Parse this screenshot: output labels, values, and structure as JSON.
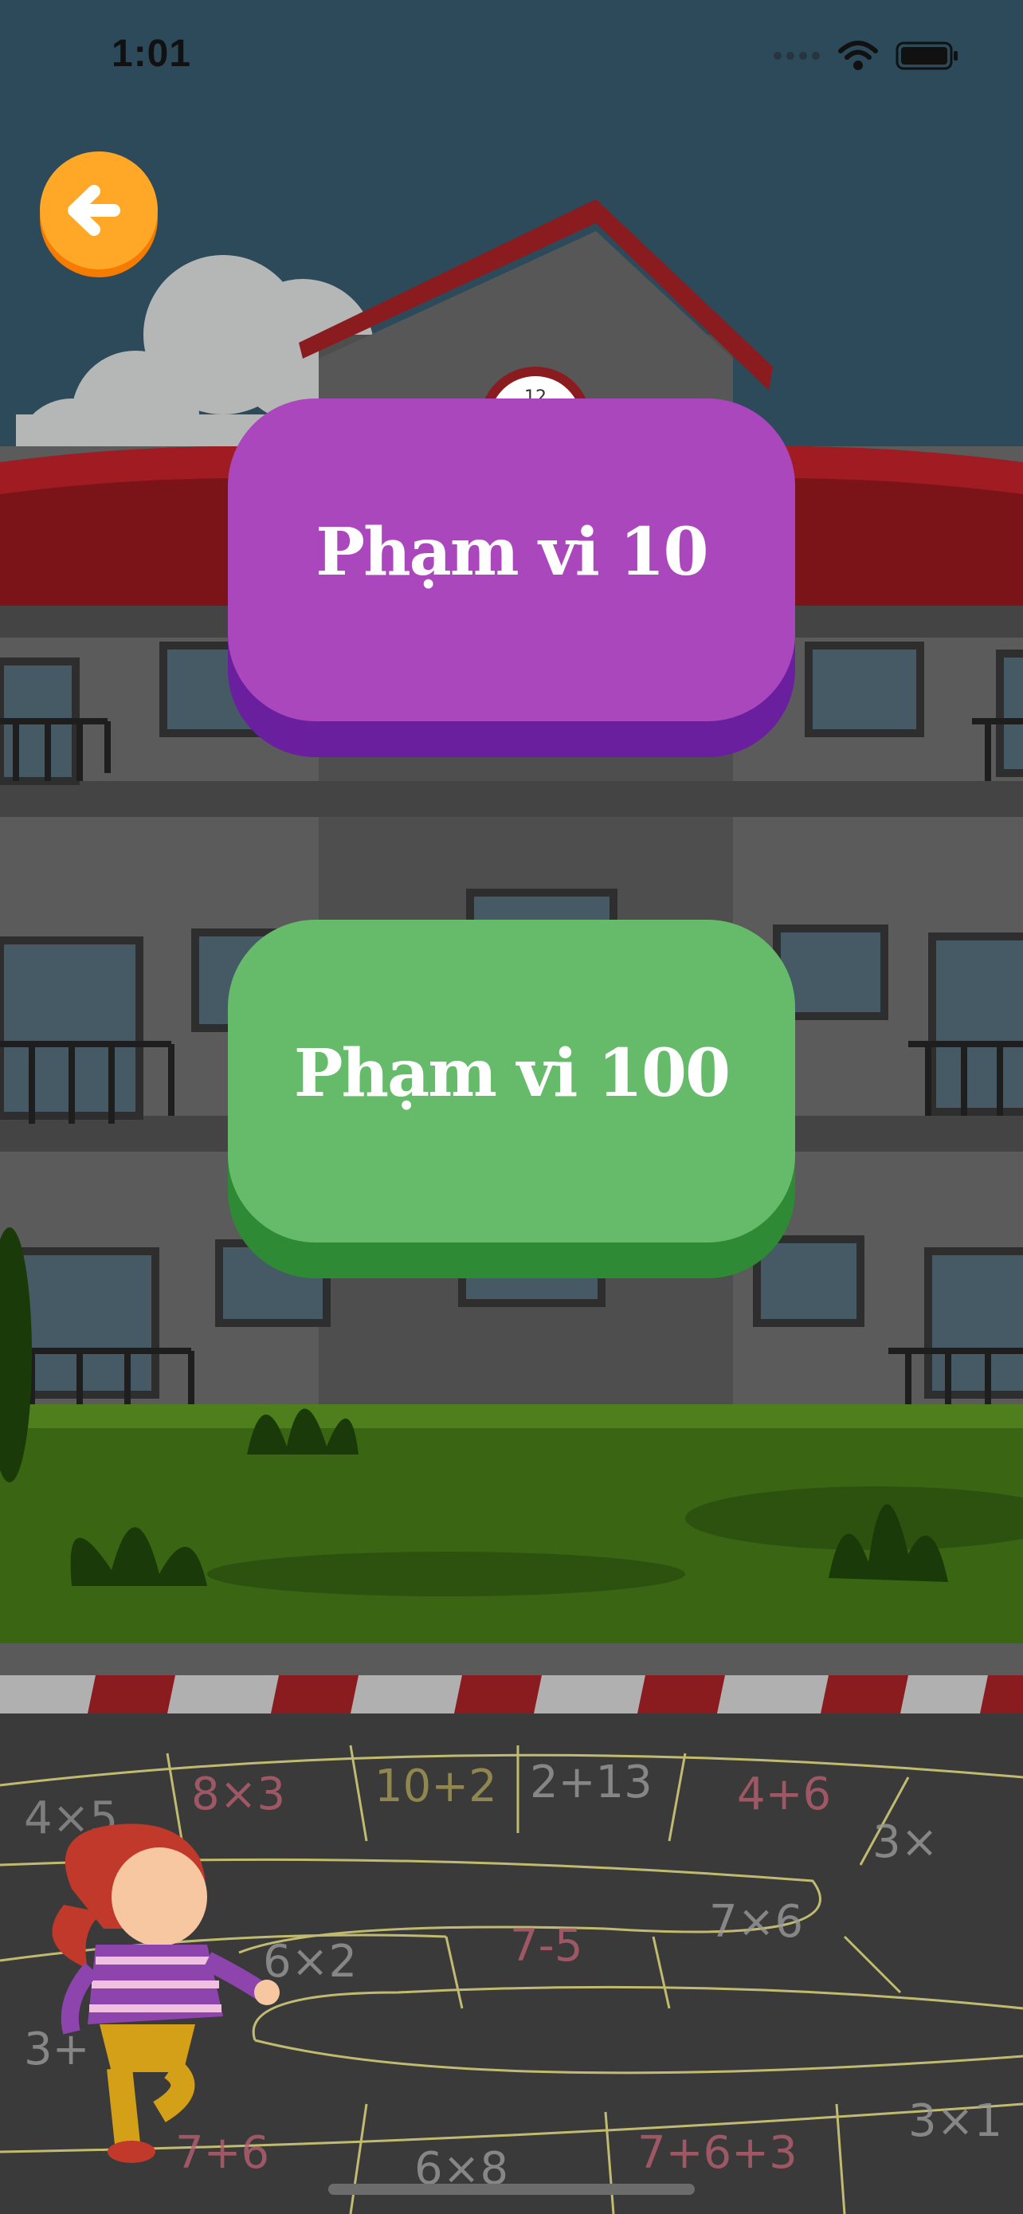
{
  "status_bar": {
    "time": "1:01"
  },
  "buttons": {
    "range_10": "Phạm vi 10",
    "range_100": "Phạm vi 100"
  },
  "icons": {
    "back": "arrow-left-icon",
    "wifi": "wifi-icon",
    "battery": "battery-icon",
    "signal": "signal-icon"
  },
  "colors": {
    "back_button": "#ffa726",
    "range_10_face": "#ab47bc",
    "range_10_shadow": "#6a1f9e",
    "range_100_face": "#66bb6a",
    "range_100_shadow": "#2f8a36"
  },
  "chalk_equations": [
    "4×5",
    "8×3",
    "10+2",
    "2+13",
    "4+6",
    "3×",
    "6×2",
    "7-5",
    "7×6",
    "3+",
    "7+6",
    "6×8",
    "7+6+3",
    "3×1"
  ]
}
